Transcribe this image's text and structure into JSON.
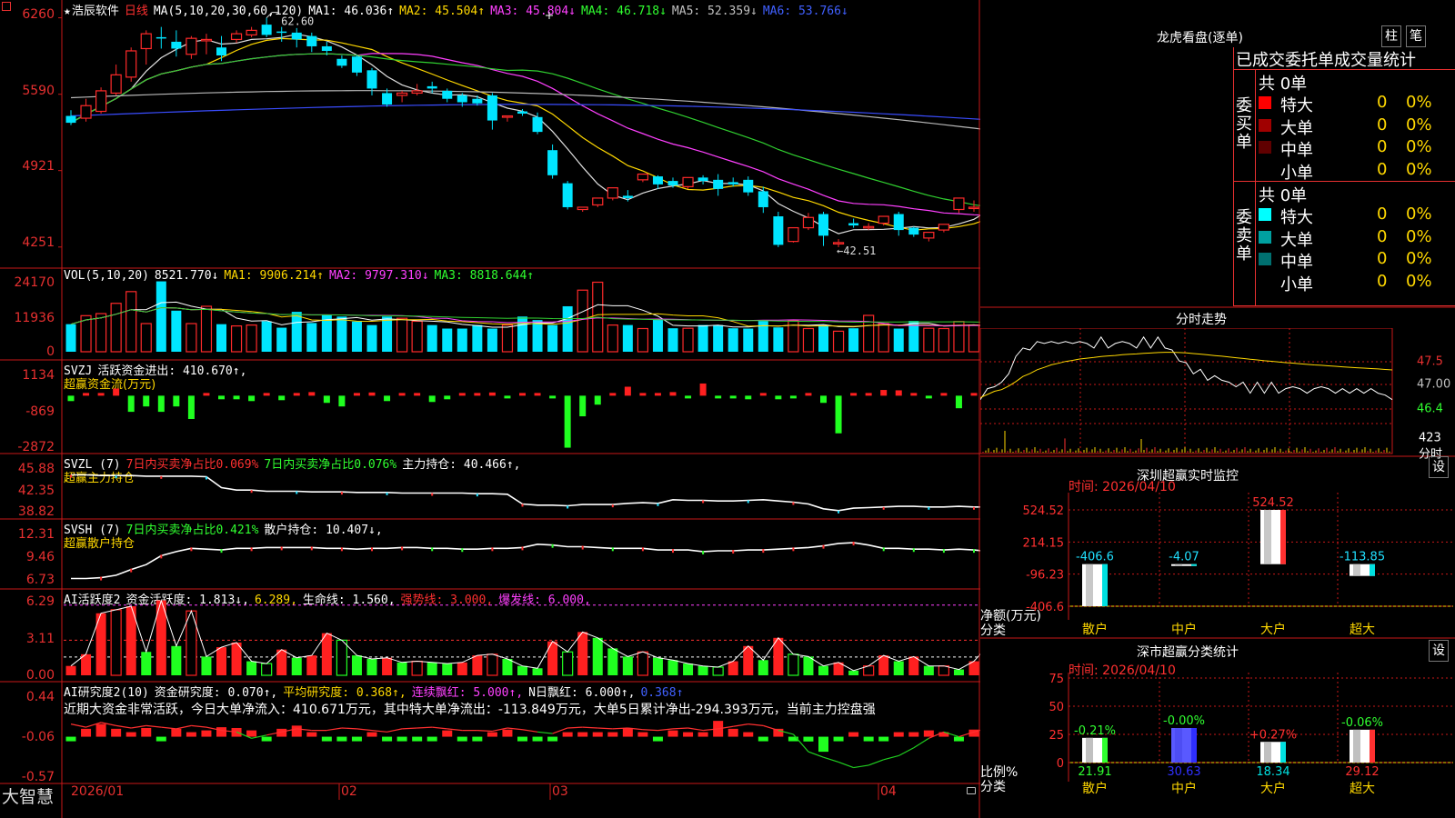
{
  "stock": {
    "name": "浩辰软件",
    "period": "日线",
    "star": "★"
  },
  "logo": "大智慧",
  "main": {
    "ma_label": "MA(5,10,20,30,60,120)",
    "ma_values": [
      {
        "name": "MA1:",
        "value": "46.036↑",
        "color": "#ffffff"
      },
      {
        "name": "MA2:",
        "value": "45.504↑",
        "color": "#ffd800"
      },
      {
        "name": "MA3:",
        "value": "45.804↓",
        "color": "#ff40ff"
      },
      {
        "name": "MA4:",
        "value": "46.718↓",
        "color": "#30ff30"
      },
      {
        "name": "MA5:",
        "value": "52.359↓",
        "color": "#c0c0c0"
      },
      {
        "name": "MA6:",
        "value": "53.766↓",
        "color": "#4060ff"
      }
    ],
    "yticks": [
      "6260",
      "5590",
      "4921",
      "4251"
    ],
    "high_label": "62.60",
    "low_label": "←42.51",
    "candles": [
      [
        54.0,
        54.5,
        53.4,
        53.2
      ],
      [
        53.8,
        55.5,
        54.9,
        53.5
      ],
      [
        54.4,
        56.5,
        56.2,
        54.2
      ],
      [
        56.0,
        58.5,
        57.6,
        55.8
      ],
      [
        57.4,
        60.0,
        59.7,
        57.0
      ],
      [
        59.9,
        61.5,
        61.2,
        58.5
      ],
      [
        60.9,
        61.8,
        60.8,
        59.9
      ],
      [
        60.5,
        61.5,
        59.9,
        59.2
      ],
      [
        59.4,
        61.0,
        60.8,
        59.0
      ],
      [
        60.6,
        61.2,
        60.7,
        59.4
      ],
      [
        60.0,
        61.0,
        59.3,
        58.8
      ],
      [
        60.7,
        61.5,
        61.2,
        60.4
      ],
      [
        61.1,
        61.8,
        61.5,
        60.9
      ],
      [
        62.0,
        62.6,
        61.1,
        60.9
      ],
      [
        61.4,
        61.8,
        61.3,
        60.5
      ],
      [
        61.3,
        61.7,
        60.7,
        60.0
      ],
      [
        61.0,
        61.3,
        60.1,
        59.6
      ],
      [
        60.1,
        60.5,
        59.7,
        59.3
      ],
      [
        59.0,
        59.3,
        58.4,
        58.2
      ],
      [
        59.2,
        59.3,
        57.8,
        57.5
      ],
      [
        58.0,
        58.2,
        56.4,
        55.8
      ],
      [
        56.0,
        56.4,
        55.0,
        54.8
      ],
      [
        55.8,
        56.2,
        56.0,
        55.2
      ],
      [
        56.0,
        56.8,
        56.2,
        55.8
      ],
      [
        56.6,
        57.0,
        56.4,
        56.0
      ],
      [
        56.2,
        56.4,
        55.5,
        55.2
      ],
      [
        55.8,
        56.0,
        55.2,
        54.8
      ],
      [
        55.5,
        55.8,
        55.1,
        54.9
      ],
      [
        55.8,
        56.0,
        53.6,
        52.8
      ],
      [
        53.9,
        54.0,
        54.0,
        53.5
      ],
      [
        54.4,
        54.6,
        54.2,
        54.0
      ],
      [
        53.9,
        54.3,
        52.6,
        52.4
      ],
      [
        51.0,
        51.5,
        48.8,
        48.5
      ],
      [
        48.1,
        48.3,
        46.0,
        45.8
      ],
      [
        45.8,
        46.0,
        46.0,
        45.6
      ],
      [
        46.2,
        46.4,
        46.8,
        46.0
      ],
      [
        46.8,
        47.5,
        47.7,
        46.6
      ],
      [
        47.0,
        47.5,
        46.8,
        46.5
      ],
      [
        48.4,
        48.8,
        48.9,
        48.2
      ],
      [
        48.7,
        48.8,
        48.0,
        47.6
      ],
      [
        48.3,
        48.6,
        47.9,
        47.7
      ],
      [
        47.8,
        48.5,
        48.6,
        47.6
      ],
      [
        48.6,
        48.8,
        48.3,
        48.0
      ],
      [
        48.4,
        48.9,
        47.6,
        47.0
      ],
      [
        48.2,
        48.6,
        48.0,
        47.8
      ],
      [
        48.4,
        48.7,
        47.3,
        47.0
      ],
      [
        47.4,
        47.8,
        46.0,
        45.5
      ],
      [
        45.2,
        45.6,
        42.7,
        42.5
      ],
      [
        43.0,
        44.0,
        44.2,
        42.9
      ],
      [
        44.2,
        45.5,
        45.1,
        44.0
      ],
      [
        45.4,
        45.6,
        43.5,
        42.6
      ],
      [
        42.8,
        43.2,
        42.9,
        42.5
      ],
      [
        44.6,
        45.0,
        44.4,
        44.2
      ],
      [
        44.3,
        44.6,
        44.3,
        44.0
      ],
      [
        44.6,
        45.0,
        45.2,
        44.4
      ],
      [
        45.4,
        45.6,
        44.0,
        43.5
      ],
      [
        44.2,
        44.3,
        43.6,
        43.4
      ],
      [
        43.3,
        43.8,
        43.8,
        43.0
      ],
      [
        44.0,
        44.4,
        44.5,
        43.8
      ],
      [
        45.8,
        46.1,
        46.8,
        45.5
      ],
      [
        46.0,
        46.6,
        46.0,
        45.6
      ],
      [
        47.0,
        48.0,
        47.6,
        46.8
      ]
    ]
  },
  "vol": {
    "header": [
      {
        "t": "VOL(5,10,20)",
        "color": "#ffffff"
      },
      {
        "t": "8521.770↓",
        "color": "#ffffff"
      },
      {
        "t": "MA1: 9906.214↑",
        "color": "#ffd800"
      },
      {
        "t": "MA2: 9797.310↓",
        "color": "#ff40ff"
      },
      {
        "t": "MA3: 8818.644↑",
        "color": "#30ff30"
      }
    ],
    "yticks": [
      "24170",
      "11936",
      "0"
    ],
    "values": [
      9400,
      12300,
      13000,
      16500,
      20500,
      9600,
      24000,
      14000,
      9600,
      15500,
      9400,
      8800,
      9100,
      10400,
      8200,
      13600,
      9800,
      12600,
      12000,
      10300,
      9100,
      12000,
      11400,
      10400,
      9100,
      7900,
      7900,
      9100,
      7900,
      9100,
      12000,
      10800,
      9100,
      15500,
      21000,
      23700,
      9100,
      9100,
      7900,
      11000,
      8000,
      8000,
      9100,
      9100,
      8000,
      7900,
      10500,
      8300,
      10500,
      7900,
      9100,
      7000,
      8000,
      12400,
      9600,
      7900,
      10500,
      8000,
      7900,
      10300,
      9100,
      7500,
      10300,
      9600,
      7900
    ]
  },
  "svzj": {
    "header": [
      {
        "t": "SVZJ",
        "color": "#ffffff"
      },
      {
        "t": "活跃资金进出: 410.670↑,",
        "color": "#ffffff"
      }
    ],
    "subtitle": "超赢资金流(万元)",
    "yticks": [
      "1134",
      "-869",
      "-2872"
    ],
    "values": [
      -300,
      50,
      0,
      400,
      -900,
      -600,
      -900,
      -600,
      -1300,
      0,
      -200,
      -200,
      -300,
      120,
      -250,
      0,
      200,
      -400,
      -600,
      0,
      180,
      -300,
      80,
      100,
      -350,
      -200,
      120,
      0,
      180,
      -80,
      120,
      0,
      -100,
      -2900,
      -1150,
      -500,
      120,
      500,
      150,
      100,
      200,
      -80,
      680,
      -150,
      -120,
      -200,
      80,
      -200,
      -80,
      120,
      -400,
      -2100,
      120,
      130,
      320,
      300,
      120,
      -120,
      120,
      -700,
      150,
      0,
      300
    ]
  },
  "svzl": {
    "header": [
      {
        "t": "SVZL (7)",
        "color": "#ffffff"
      },
      {
        "t": "7日内买卖净占比0.069%",
        "color": "#ff3030"
      },
      {
        "t": "7日内买卖净占比0.076%",
        "color": "#30ff30"
      },
      {
        "t": "主力持仓: 40.466↑,",
        "color": "#ffffff"
      }
    ],
    "subtitle": "超赢主力持仓",
    "yticks": [
      "45.88",
      "42.35",
      "38.82"
    ],
    "values": [
      44.9,
      44.9,
      44.8,
      44.8,
      44.8,
      44.7,
      44.7,
      44.7,
      44.7,
      44.6,
      42.8,
      42.4,
      42.4,
      42.2,
      42.2,
      42.2,
      42.1,
      42.1,
      42.1,
      42.0,
      42.0,
      42.0,
      41.9,
      41.9,
      41.9,
      41.9,
      41.9,
      41.8,
      41.8,
      41.7,
      40.1,
      39.9,
      39.9,
      39.8,
      40.0,
      40.0,
      40.0,
      40.2,
      40.3,
      40.2,
      40.8,
      40.7,
      40.7,
      40.6,
      40.6,
      40.7,
      40.8,
      40.6,
      40.4,
      40.1,
      39.3,
      39.0,
      39.4,
      39.5,
      39.6,
      39.7,
      39.7,
      39.6,
      39.6,
      39.7,
      39.6,
      39.6,
      39.6,
      39.6
    ]
  },
  "svsh": {
    "header": [
      {
        "t": "SVSH (7)",
        "color": "#ffffff"
      },
      {
        "t": "7日内买卖净占比0.421%",
        "color": "#30ff30"
      },
      {
        "t": "散户持仓: 10.407↓,",
        "color": "#ffffff"
      }
    ],
    "subtitle": "超赢散户持仓",
    "yticks": [
      "12.31",
      "9.46",
      "6.73"
    ],
    "values": [
      6.9,
      6.9,
      7.0,
      7.3,
      8.0,
      8.6,
      9.7,
      10.2,
      10.6,
      10.5,
      10.4,
      10.6,
      10.6,
      10.7,
      10.7,
      10.7,
      10.7,
      10.6,
      10.6,
      10.5,
      10.6,
      10.6,
      10.7,
      10.7,
      10.6,
      10.6,
      10.5,
      10.5,
      10.6,
      10.6,
      10.7,
      11.1,
      11.0,
      10.8,
      10.8,
      10.7,
      10.6,
      10.6,
      10.6,
      10.4,
      10.4,
      10.4,
      10.2,
      10.3,
      10.3,
      10.4,
      10.4,
      10.5,
      10.6,
      10.7,
      10.9,
      11.2,
      11.3,
      11.0,
      10.6,
      10.6,
      10.5,
      10.5,
      10.4,
      10.5,
      10.4,
      10.2,
      10.1,
      9.9,
      9.8
    ]
  },
  "ai1": {
    "header": [
      {
        "t": "AI活跃度2",
        "color": "#ffffff"
      },
      {
        "t": "资金活跃度: 1.813↓,",
        "color": "#ffffff"
      },
      {
        "t": "6.289,",
        "color": "#ffd800"
      },
      {
        "t": "生命线: 1.560,",
        "color": "#ffffff"
      },
      {
        "t": "强势线: 3.000,",
        "color": "#ff3030"
      },
      {
        "t": "爆发线: 6.000,",
        "color": "#ff40ff"
      }
    ],
    "yticks": [
      "6.29",
      "3.11",
      "0.00"
    ],
    "values": [
      0.8,
      1.8,
      5.3,
      5.6,
      5.9,
      2.0,
      6.4,
      2.5,
      5.5,
      1.6,
      2.4,
      2.8,
      1.2,
      1.0,
      2.2,
      1.5,
      1.7,
      3.6,
      3.0,
      1.7,
      1.4,
      1.5,
      1.1,
      1.2,
      1.1,
      1.0,
      1.1,
      1.7,
      1.8,
      1.4,
      0.8,
      0.6,
      2.9,
      2.0,
      3.7,
      3.2,
      2.3,
      1.6,
      2.0,
      1.5,
      1.3,
      1.0,
      0.8,
      0.7,
      1.2,
      2.5,
      1.3,
      3.2,
      1.8,
      1.6,
      0.8,
      1.1,
      0.4,
      0.8,
      1.7,
      1.2,
      1.6,
      0.8,
      0.8,
      0.5,
      1.2,
      2.6,
      2.5,
      2.1,
      1.9
    ]
  },
  "ai2": {
    "header": [
      {
        "t": "AI研究度2(10)",
        "color": "#ffffff"
      },
      {
        "t": "资金研究度: 0.070↑,",
        "color": "#ffffff"
      },
      {
        "t": "平均研究度: 0.368↑,",
        "color": "#ffd800"
      },
      {
        "t": "连续飘红: 5.000↑,",
        "color": "#ff40ff"
      },
      {
        "t": "N日飘红: 6.000↑,",
        "color": "#ffffff"
      },
      {
        "t": "0.368↑",
        "color": "#4060ff"
      }
    ],
    "yticks": [
      "0.44",
      "-0.06",
      "-0.57"
    ],
    "comment": "近期大资金非常活跃，今日大单净流入：410.671万元，其中特大单净流出：-113.849万元，大单5日累计净出-294.393万元，当前主力控盘强",
    "values": [
      -0.08,
      0.04,
      0.1,
      0.04,
      -0.06,
      0.05,
      -0.1,
      0.04,
      -0.06,
      0.02,
      0.06,
      0.05,
      0.02,
      -0.07,
      0.04,
      0.08,
      -0.06,
      -0.07,
      -0.07,
      -0.07,
      -0.06,
      -0.07,
      -0.07,
      -0.08,
      -0.08,
      0.02,
      -0.09,
      -0.08,
      -0.05,
      0.03,
      -0.07,
      -0.08,
      -0.07,
      -0.06,
      -0.05,
      -0.06,
      -0.06,
      0.05,
      -0.05,
      -0.08,
      0.02,
      -0.06,
      -0.03,
      0.14,
      0.04,
      -0.06,
      -0.07,
      0.04,
      -0.08,
      -0.12,
      -0.25,
      -0.08,
      -0.06,
      -0.07,
      -0.08,
      -0.06,
      -0.05,
      0.02,
      -0.06,
      -0.08,
      0.03,
      0.04,
      0.05,
      0.04,
      0.03
    ],
    "line": [
      0.1,
      0.06,
      0.12,
      0.08,
      0.05,
      0.08,
      0.06,
      0.04,
      0.08,
      0.06,
      0.02,
      0.0,
      -0.08,
      -0.04,
      0.0,
      0.04,
      0.02,
      0.02,
      0.05,
      0.04,
      0.02,
      0.0,
      0.04,
      0.05,
      0.06,
      0.04,
      0.02,
      0.02,
      0.01,
      0.05,
      0.03,
      0.0,
      -0.02,
      0.05,
      0.06,
      0.05,
      0.04,
      0.05,
      0.03,
      0.02,
      0.04,
      0.05,
      0.02,
      0.04,
      0.07,
      0.1,
      0.08,
      0.02,
      -0.03,
      -0.25,
      -0.32,
      -0.38,
      -0.45,
      -0.42,
      -0.35,
      -0.3,
      -0.2,
      -0.08,
      0.0,
      -0.06,
      0.0,
      0.05,
      0.15,
      0.2,
      0.32
    ]
  },
  "xaxis": {
    "labels": [
      "2026/01",
      "02",
      "03",
      "04"
    ]
  },
  "right": {
    "lh_title": "龙虎看盘(逐单)",
    "btn1": "柱",
    "btn2": "笔",
    "stats_title": "已成交委托单成交量统计",
    "buy_title": "委买单",
    "sell_title": "委卖单",
    "buy_total": "共 0单",
    "sell_total": "共 0单",
    "buy_rows": [
      {
        "label": "特大",
        "color": "#ff0000",
        "count": "0",
        "pct": "0%"
      },
      {
        "label": "大单",
        "color": "#a00000",
        "count": "0",
        "pct": "0%"
      },
      {
        "label": "中单",
        "color": "#600000",
        "count": "0",
        "pct": "0%"
      },
      {
        "label": "小单",
        "color": "",
        "count": "0",
        "pct": "0%"
      }
    ],
    "sell_rows": [
      {
        "label": "特大",
        "color": "#00ffff",
        "count": "0",
        "pct": "0%"
      },
      {
        "label": "大单",
        "color": "#00a0a0",
        "count": "0",
        "pct": "0%"
      },
      {
        "label": "中单",
        "color": "#007070",
        "count": "0",
        "pct": "0%"
      },
      {
        "label": "小单",
        "color": "",
        "count": "0",
        "pct": "0%"
      }
    ],
    "intraday_title": "分时走势",
    "intraday_yticks": [
      "47.5",
      "47.00",
      "46.4",
      "423",
      "分时"
    ],
    "intraday": [
      46.7,
      46.8,
      46.9,
      46.9,
      47.1,
      47.3,
      47.5,
      47.4,
      47.6,
      47.5,
      47.6,
      47.5,
      47.6,
      47.5,
      47.6,
      47.5,
      47.5,
      47.6,
      47.5,
      47.5,
      47.6,
      47.5,
      47.5,
      47.6,
      47.5,
      47.6,
      47.5,
      47.4,
      47.3,
      47.2,
      47.1,
      47.1,
      47.0,
      47.0,
      47.0,
      46.9,
      46.9,
      46.9,
      46.8,
      46.9,
      46.8,
      46.9,
      46.8,
      46.8,
      46.9,
      46.8,
      46.8,
      46.8,
      46.9,
      46.8,
      46.8,
      46.8,
      46.8,
      46.8,
      46.8,
      46.8,
      46.8,
      46.7,
      46.7
    ],
    "sz_title": "深圳超赢实时监控",
    "sz_btn": "设",
    "sz_time": "时间: 2026/04/10",
    "sz_yticks": [
      "524.52",
      "214.15",
      "-96.23",
      "-406.6"
    ],
    "sz_ylabel": "净额(万元)",
    "sz_xlabel": "分类",
    "sz_bars": [
      {
        "cat": "散户",
        "value": -406.6,
        "label": "-406.6",
        "color": "#00e0e0"
      },
      {
        "cat": "中户",
        "value": -4.07,
        "label": "-4.07",
        "color": "#00e0e0"
      },
      {
        "cat": "大户",
        "value": 524.52,
        "label": "524.52",
        "color": "#ff3030"
      },
      {
        "cat": "超大",
        "value": -113.85,
        "label": "-113.85",
        "color": "#00e0e0"
      }
    ],
    "cls_title": "深市超赢分类统计",
    "cls_btn": "设",
    "cls_time": "时间: 2026/04/10",
    "cls_yticks": [
      "75",
      "50",
      "25",
      "0"
    ],
    "cls_ylabel": "比例%",
    "cls_xlabel": "分类",
    "cls_bars": [
      {
        "cat": "散户",
        "value": 21.91,
        "label": "21.91",
        "delta": "-0.21%",
        "color": "#30ff30",
        "dcolor": "#30ff30"
      },
      {
        "cat": "中户",
        "value": 30.63,
        "label": "30.63",
        "delta": "-0.00%",
        "color": "#3030ff",
        "dcolor": "#30ff30"
      },
      {
        "cat": "大户",
        "value": 18.34,
        "label": "18.34",
        "delta": "+0.27%",
        "color": "#00e0e0",
        "dcolor": "#ff3030"
      },
      {
        "cat": "超大",
        "value": 29.12,
        "label": "29.12",
        "delta": "-0.06%",
        "color": "#ff3030",
        "dcolor": "#30ff30"
      }
    ]
  }
}
